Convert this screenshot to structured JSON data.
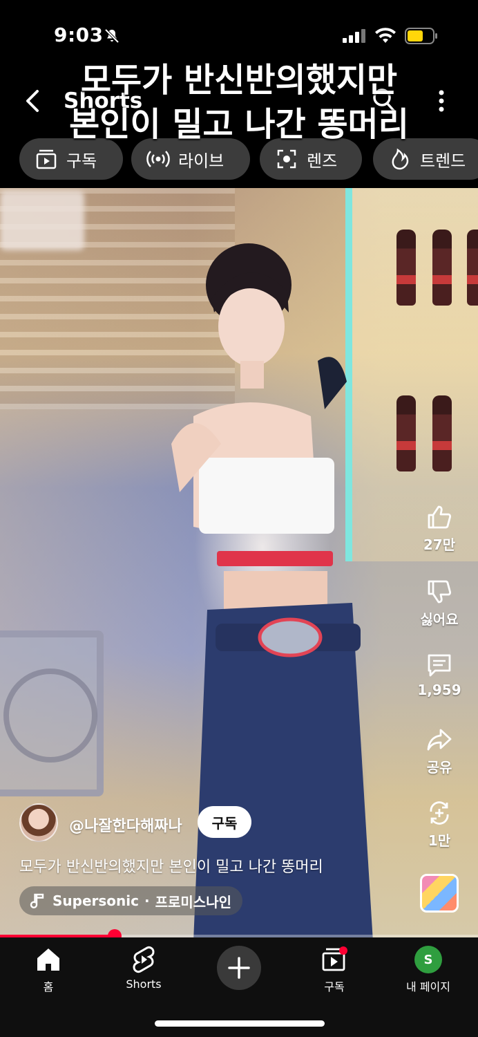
{
  "status_bar": {
    "time": "9:03"
  },
  "overlay_title": {
    "line1": "모두가 반신반의했지만",
    "line2": "본인이 밀고 나간 똥머리"
  },
  "header": {
    "label": "Shorts"
  },
  "chips": [
    {
      "label": "구독",
      "icon": "subscriptions-icon"
    },
    {
      "label": "라이브",
      "icon": "live-icon"
    },
    {
      "label": "렌즈",
      "icon": "lens-icon"
    },
    {
      "label": "트렌드",
      "icon": "trending-icon"
    }
  ],
  "actions": {
    "like": {
      "count": "27만",
      "icon": "thumbs-up-icon"
    },
    "dislike": {
      "label": "싫어요",
      "icon": "thumbs-down-icon"
    },
    "comments": {
      "count": "1,959",
      "icon": "comment-icon"
    },
    "share": {
      "label": "공유",
      "icon": "share-icon"
    },
    "remix": {
      "count": "1만",
      "icon": "remix-icon"
    }
  },
  "channel": {
    "name": "@나잘한다해짜나",
    "subscribe_label": "구독"
  },
  "caption": "모두가 반신반의했지만 본인이 밀고 나간 똥머리",
  "music": {
    "song": "Supersonic",
    "artist": "프로미스나인",
    "separator": " · "
  },
  "progress": {
    "fraction": 0.24,
    "color": "#ff0033"
  },
  "bottom_nav": {
    "home": "홈",
    "shorts": "Shorts",
    "subscriptions": "구독",
    "profile": "내 페이지",
    "profile_initial": "S"
  },
  "colors": {
    "accent": "#ff0033",
    "battery": "#ffd60a",
    "profile": "#2f9e3f"
  }
}
